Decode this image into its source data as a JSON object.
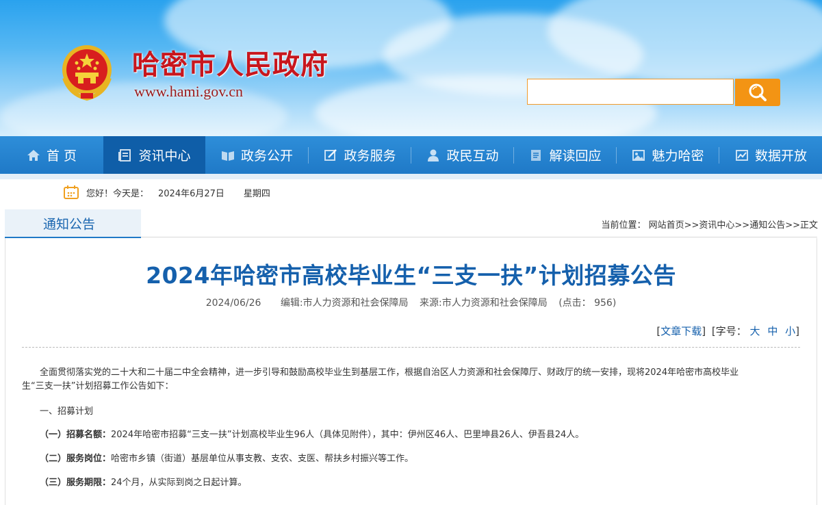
{
  "header": {
    "site_title": "哈密市人民政府",
    "site_url": "www.hami.gov.cn",
    "search": {
      "placeholder": "",
      "button_icon": "search-icon"
    }
  },
  "nav": {
    "items": [
      {
        "label": "首 页",
        "icon": "home-icon",
        "active": false
      },
      {
        "label": "资讯中心",
        "icon": "news-icon",
        "active": true
      },
      {
        "label": "政务公开",
        "icon": "book-icon",
        "active": false
      },
      {
        "label": "政务服务",
        "icon": "edit-icon",
        "active": false
      },
      {
        "label": "政民互动",
        "icon": "user-icon",
        "active": false
      },
      {
        "label": "解读回应",
        "icon": "document-icon",
        "active": false
      },
      {
        "label": "魅力哈密",
        "icon": "image-icon",
        "active": false
      },
      {
        "label": "数据开放",
        "icon": "chart-icon",
        "active": false
      }
    ]
  },
  "date_bar": {
    "greeting": "您好！今天是：",
    "date": "2024年6月27日",
    "weekday": "星期四"
  },
  "section": {
    "tab_label": "通知公告",
    "breadcrumb": "当前位置： 网站首页>>资讯中心>>通知公告>>正文"
  },
  "article": {
    "title": "2024年哈密市高校毕业生“三支一扶”计划招募公告",
    "date": "2024/06/26",
    "editor": "编辑:市人力资源和社会保障局",
    "source": "来源:市人力资源和社会保障局",
    "clicks": "(点击： 956)",
    "tools": {
      "download_open": "[",
      "download": "文章下载",
      "download_close": "]",
      "font_size_label": "[字号：",
      "big": "大",
      "medium": "中",
      "small": "小",
      "close": "]"
    },
    "intro_line1": "全面贯彻落实党的二十大和二十届二中全会精神，进一步引导和鼓励高校毕业生到基层工作，根据自治区人力资源和社会保障厅、财政厅的统一安排，现将2024年哈密市高校毕业",
    "intro_line2": "生“三支一扶”计划招募工作公告如下：",
    "section1": "一、招募计划",
    "items": [
      {
        "label": "（一）招募名额：",
        "text": "2024年哈密市招募“三支一扶”计划高校毕业生96人（具体见附件），其中：伊州区46人、巴里坤县26人、伊吾县24人。"
      },
      {
        "label": "（二）服务岗位：",
        "text": "哈密市乡镇（街道）基层单位从事支教、支农、支医、帮扶乡村振兴等工作。"
      },
      {
        "label": "（三）服务期限：",
        "text": "24个月，从实际到岗之日起计算。"
      }
    ]
  },
  "colors": {
    "nav_bg": "#1f79c7",
    "nav_active": "#0f5ea8",
    "title_red": "#c8161d",
    "article_title": "#1560ac",
    "search_button": "#f39414"
  }
}
